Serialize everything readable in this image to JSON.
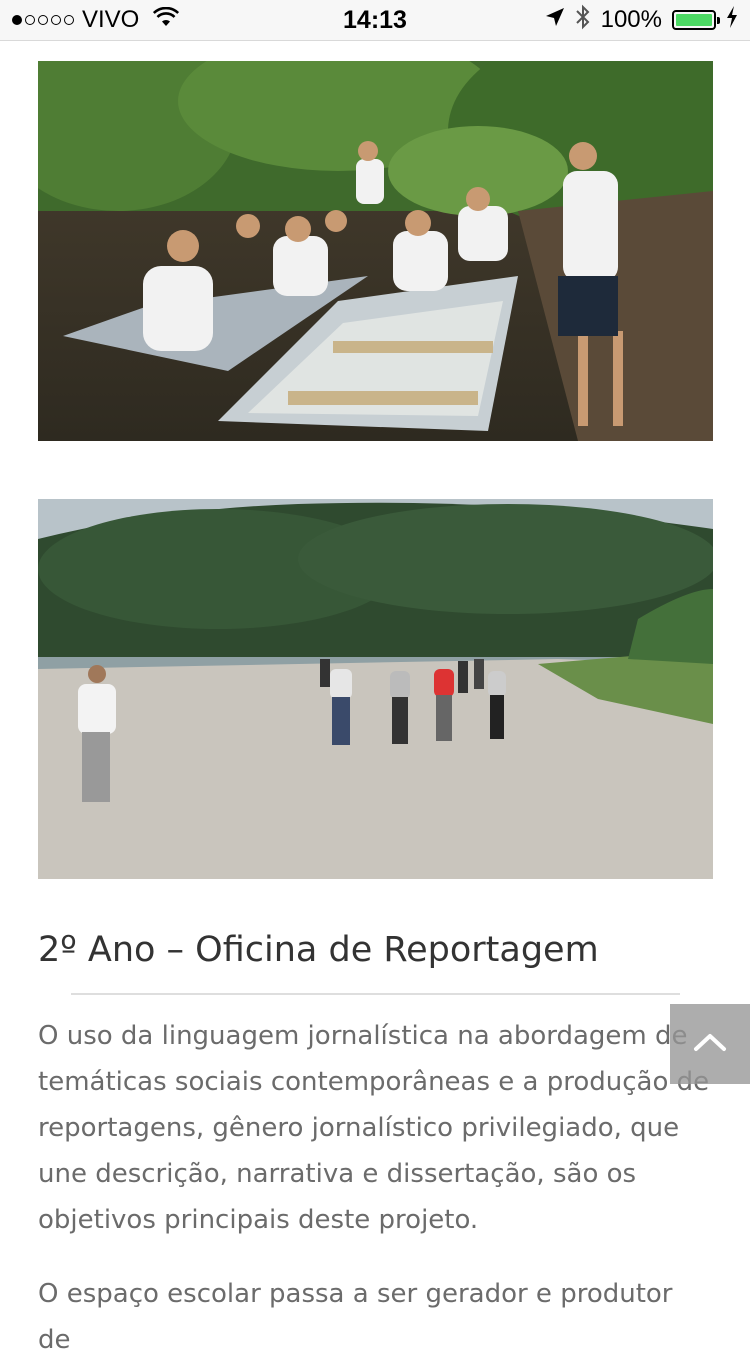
{
  "status_bar": {
    "carrier": "VIVO",
    "time": "14:13",
    "battery_percent": "100%",
    "signal_bars": 1,
    "signal_total": 5,
    "icons": [
      "wifi-icon",
      "location-arrow-icon",
      "bluetooth-icon",
      "battery-icon",
      "charging-icon"
    ]
  },
  "gallery": [
    {
      "name": "photo-students-boats",
      "subject": "students in aluminium boats on a mangrove river"
    },
    {
      "name": "photo-beach-walk",
      "subject": "group walking on a beach below a forested hill"
    }
  ],
  "article": {
    "title": "2º Ano – Oficina de Reportagem",
    "paragraphs": [
      "O uso da linguagem jornalística na abordagem de temáticas sociais contemporâneas e a produção de reportagens, gênero jornalístico privilegiado, que une descrição, narrativa e dissertação, são os objetivos principais deste projeto.",
      "O espaço escolar passa a ser gerador e produtor de"
    ]
  },
  "back_to_top": {
    "icon": "chevron-up-icon"
  },
  "colors": {
    "battery": "#4cd964",
    "text": "#6b6b6b",
    "title": "#333333",
    "button": "#969696"
  }
}
